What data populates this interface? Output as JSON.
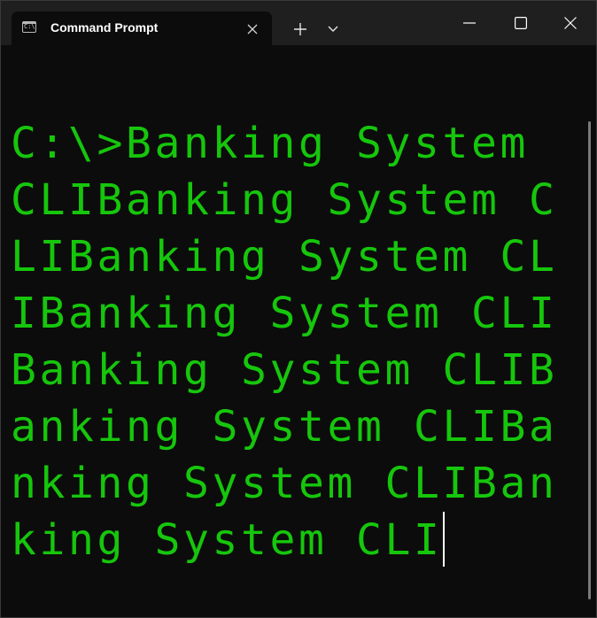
{
  "window": {
    "tab_title": "Command Prompt",
    "tab_close_icon": "close-icon",
    "new_tab_icon": "plus-icon",
    "dropdown_icon": "chevron-down-icon",
    "minimize_icon": "minimize-icon",
    "maximize_icon": "maximize-icon",
    "close_icon": "close-icon"
  },
  "console": {
    "output": "C:\\>Banking System CLIBanking System CLIBanking System CLIBanking System CLIBanking System CLIBanking System CLIBanking System CLIBanking System CLI"
  },
  "colors": {
    "text_green": "#16c60c",
    "background": "#0c0c0c",
    "titlebar": "#1f1f1f"
  }
}
